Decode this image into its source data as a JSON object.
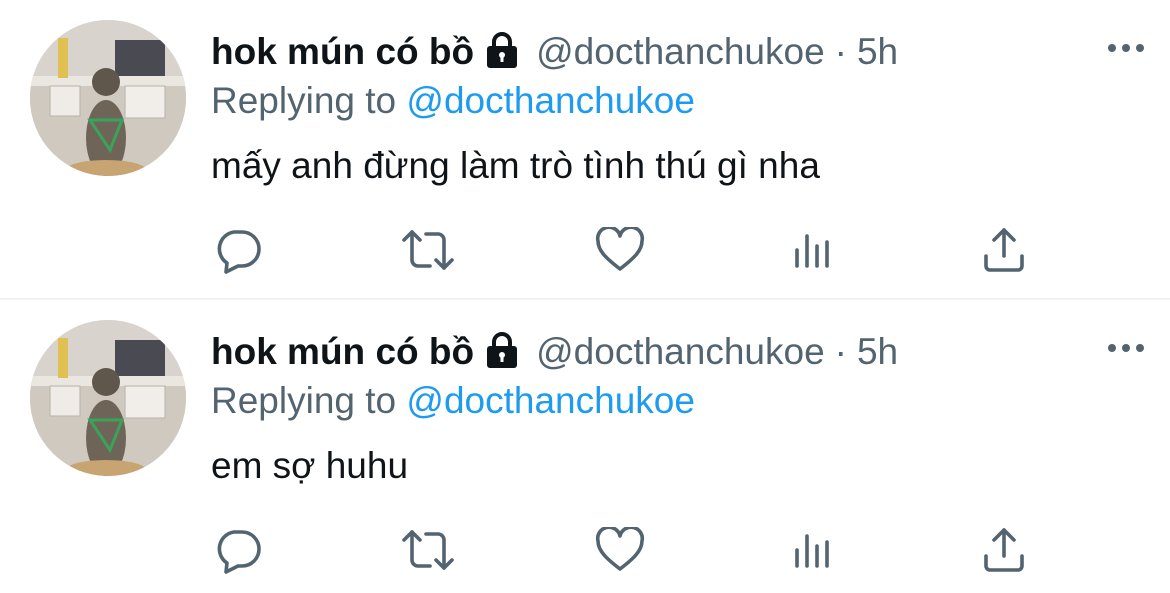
{
  "tweets": [
    {
      "display_name": "hok mún có bồ",
      "handle": "@docthanchukoe",
      "separator": "·",
      "time": "5h",
      "replying_prefix": "Replying to",
      "replying_handle": "@docthanchukoe",
      "text": "mấy anh đừng làm trò tình thú gì nha"
    },
    {
      "display_name": "hok mún có bồ",
      "handle": "@docthanchukoe",
      "separator": "·",
      "time": "5h",
      "replying_prefix": "Replying to",
      "replying_handle": "@docthanchukoe",
      "text": "em sợ huhu"
    }
  ],
  "icons": {
    "lock": "lock-icon",
    "more": "more-icon",
    "reply": "reply-icon",
    "retweet": "retweet-icon",
    "like": "heart-icon",
    "views": "analytics-icon",
    "share": "share-icon"
  },
  "colors": {
    "text": "#0f1419",
    "secondary": "#536471",
    "accent": "#1d9bf0",
    "divider": "#eff3f4"
  }
}
